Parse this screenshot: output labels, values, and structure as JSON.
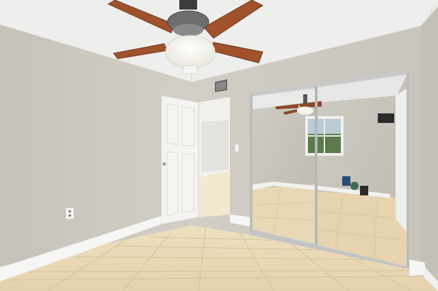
{
  "scene": {
    "colors": {
      "wall": "#cdc8bf",
      "wall_shadow": "#bdb8ae",
      "ceiling": "#efefed",
      "floor": "#ead8b5",
      "floor_grout": "#d9c6a2",
      "baseboard": "#f7f7f5",
      "door": "#f4f4f2",
      "fan_blade": "#a0522d",
      "mirror_frame": "#c9c9c9",
      "mirror_reflection_wall": "#c6c3bb"
    },
    "objects": [
      "ceiling-fan-icon",
      "air-vent-icon",
      "open-door",
      "hallway-doorway",
      "mirrored-closet-doors",
      "electrical-outlet-icon",
      "light-switch-icon",
      "tile-floor",
      "window-reflection"
    ]
  }
}
